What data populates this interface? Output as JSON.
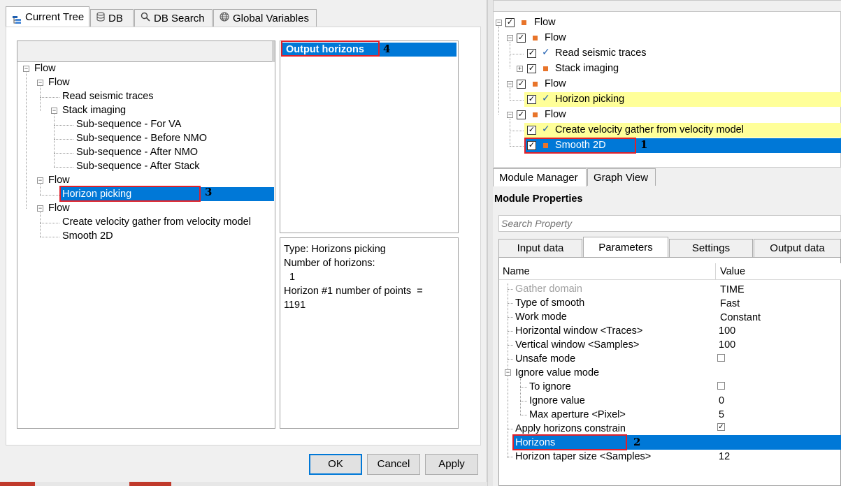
{
  "dialog": {
    "tabs": [
      "Current Tree",
      "DB",
      "DB Search",
      "Global Variables"
    ],
    "tree": {
      "root": "Flow",
      "flow1": "Flow",
      "read_seismic": "Read seismic traces",
      "stack_imaging": "Stack imaging",
      "sub1": "Sub-sequence - For VA",
      "sub2": "Sub-sequence - Before NMO",
      "sub3": "Sub-sequence - After NMO",
      "sub4": "Sub-sequence - After Stack",
      "flow2": "Flow",
      "horizon_picking": "Horizon picking",
      "flow3": "Flow",
      "create_velocity": "Create velocity gather from velocity model",
      "smooth2d": "Smooth 2D"
    },
    "output_list": {
      "item": "Output horizons"
    },
    "info": {
      "line1": "Type: Horizons picking",
      "line2": "Number of horizons:",
      "line3": "1",
      "line4": "Horizon #1 number of points  =",
      "line5": "1191"
    },
    "buttons": {
      "ok": "OK",
      "cancel": "Cancel",
      "apply": "Apply"
    }
  },
  "right_tree": {
    "flow_root": "Flow",
    "flow_a": "Flow",
    "read_seismic": "Read seismic traces",
    "stack_imaging": "Stack imaging",
    "flow_b": "Flow",
    "horizon_picking": "Horizon picking",
    "flow_c": "Flow",
    "create_velocity": "Create velocity gather from velocity model",
    "smooth2d": "Smooth 2D"
  },
  "module_tabs": [
    "Module Manager",
    "Graph View"
  ],
  "module_properties": {
    "title": "Module Properties",
    "search_placeholder": "Search Property",
    "tabs": [
      "Input data",
      "Parameters",
      "Settings",
      "Output data"
    ],
    "columns": {
      "name": "Name",
      "value": "Value"
    },
    "rows": [
      {
        "name": "Gather domain",
        "value": "TIME"
      },
      {
        "name": "Type of smooth",
        "value": "Fast"
      },
      {
        "name": "Work mode",
        "value": "Constant"
      },
      {
        "name": "Horizontal window <Traces>",
        "value": "100"
      },
      {
        "name": "Vertical window <Samples>",
        "value": "100"
      },
      {
        "name": "Unsafe mode",
        "value": ""
      },
      {
        "name": "Ignore value mode",
        "value": ""
      },
      {
        "name": "To ignore",
        "value": ""
      },
      {
        "name": "Ignore value",
        "value": "0"
      },
      {
        "name": "Max aperture <Pixel>",
        "value": "5"
      },
      {
        "name": "Apply horizons constrain",
        "value": ""
      },
      {
        "name": "Horizons",
        "value": ""
      },
      {
        "name": "Horizon taper size <Samples>",
        "value": "12"
      }
    ]
  },
  "markers": {
    "m1": "1",
    "m2": "2",
    "m3": "3",
    "m4": "4"
  },
  "colors": {
    "selection": "#0078d7",
    "highlight": "#ffff99",
    "annotation": "#e0202a",
    "module_icon": "#e8742a"
  }
}
